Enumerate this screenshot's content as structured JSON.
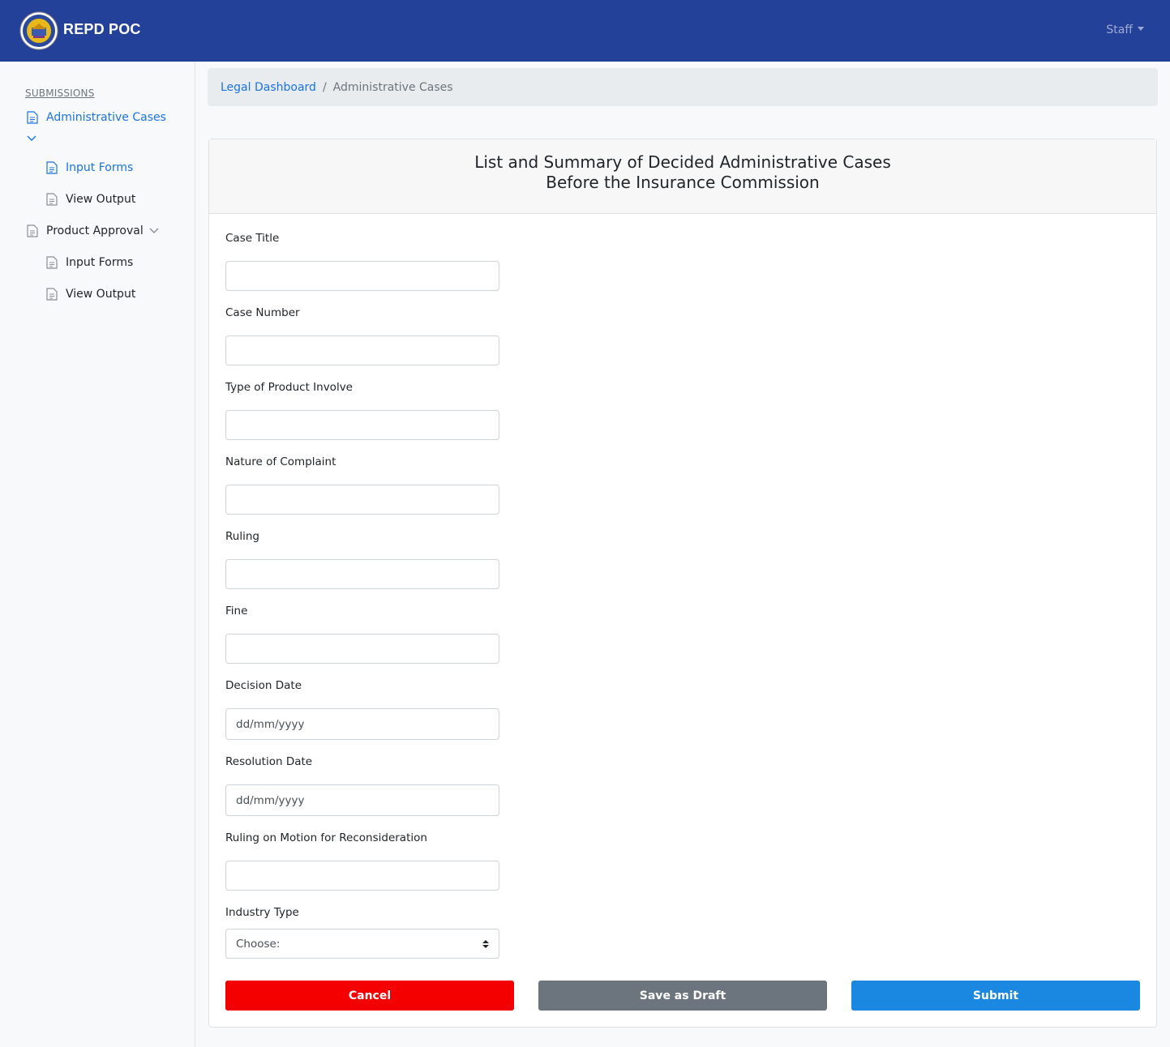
{
  "navbar": {
    "brand": "REPD POC",
    "logo_icon": "insurance-commission-seal-icon",
    "user_menu": "Staff",
    "background": "#24419a"
  },
  "sidebar": {
    "heading": "SUBMISSIONS",
    "groups": [
      {
        "label": "Administrative Cases",
        "active": true,
        "icon": "document-icon",
        "children": [
          {
            "label": "Input Forms",
            "active": true,
            "icon": "document-icon"
          },
          {
            "label": "View Output",
            "active": false,
            "icon": "document-icon"
          }
        ]
      },
      {
        "label": "Product Approval",
        "active": false,
        "icon": "document-icon",
        "children": [
          {
            "label": "Input Forms",
            "active": false,
            "icon": "document-icon"
          },
          {
            "label": "View Output",
            "active": false,
            "icon": "document-icon"
          }
        ]
      }
    ]
  },
  "breadcrumb": {
    "parent": "Legal Dashboard",
    "separator": "/",
    "current": "Administrative Cases"
  },
  "form": {
    "title_line1": "List and Summary of Decided Administrative Cases",
    "title_line2": "Before the Insurance Commission",
    "fields": [
      {
        "label": "Case Title",
        "value": ""
      },
      {
        "label": "Case Number",
        "value": ""
      },
      {
        "label": "Type of Product Involve",
        "value": ""
      },
      {
        "label": "Nature of Complaint",
        "value": ""
      },
      {
        "label": "Ruling",
        "value": ""
      },
      {
        "label": "Fine",
        "value": ""
      },
      {
        "label": "Decision Date",
        "value": "dd/mm/yyyy"
      },
      {
        "label": "Resolution Date",
        "value": "dd/mm/yyyy"
      },
      {
        "label": "Ruling on Motion for Reconsideration",
        "value": ""
      },
      {
        "label": "Industry Type",
        "value": "Choose:"
      }
    ],
    "buttons": {
      "cancel": "Cancel",
      "save_draft": "Save as Draft",
      "submit": "Submit"
    },
    "colors": {
      "cancel": "#f50000",
      "save_draft": "#6c757d",
      "submit": "#1a88e0",
      "link": "#1a73e8"
    }
  }
}
